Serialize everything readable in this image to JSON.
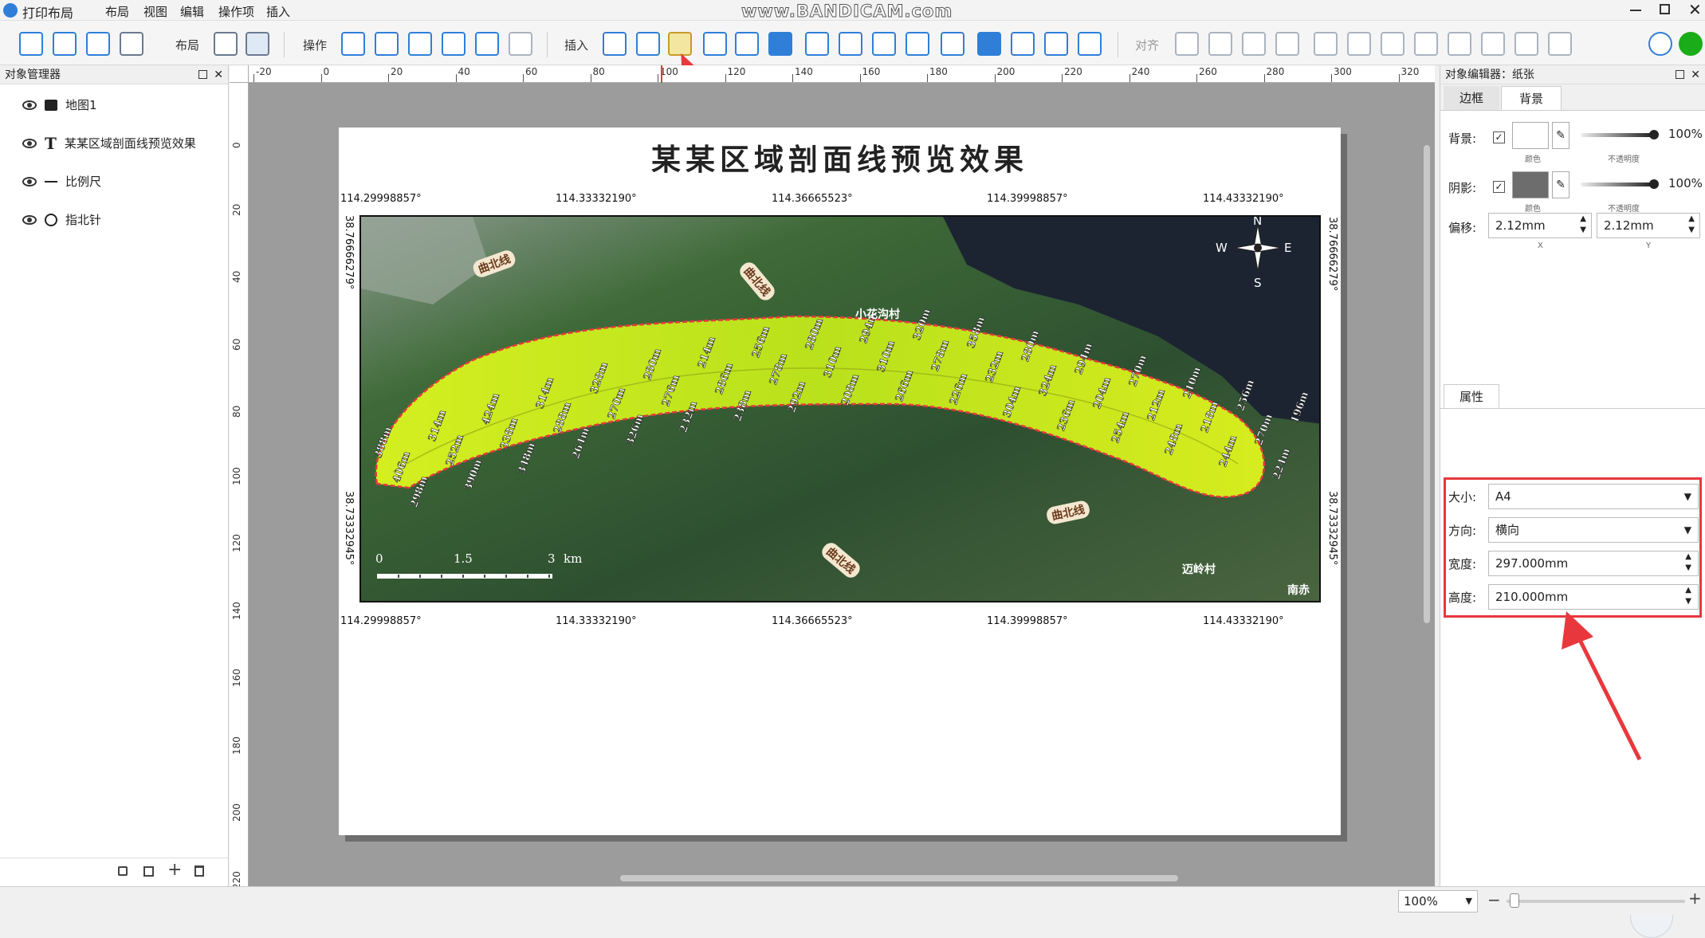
{
  "app": {
    "title": "打印布局",
    "menu": [
      "布局",
      "视图",
      "编辑",
      "操作项",
      "插入"
    ],
    "watermark": "www.BANDICAM.com"
  },
  "toolbar": {
    "layout_label": "布局",
    "ops_label": "操作",
    "insert_label": "插入",
    "align_label": "对齐"
  },
  "left_panel": {
    "title": "对象管理器",
    "items": [
      {
        "icon": "folder-icon",
        "label": "地图1"
      },
      {
        "icon": "text-icon",
        "label": "某某区域剖面线预览效果"
      },
      {
        "icon": "scalebar-icon",
        "label": "比例尺"
      },
      {
        "icon": "compass-icon",
        "label": "指北针"
      }
    ]
  },
  "rulers": {
    "top": [
      "-20",
      "0",
      "20",
      "40",
      "60",
      "80",
      "100",
      "120",
      "140",
      "160",
      "180",
      "200",
      "220",
      "240",
      "260",
      "280",
      "300",
      "320"
    ],
    "left": [
      "0",
      "20",
      "40",
      "60",
      "80",
      "100",
      "120",
      "140",
      "160",
      "180",
      "200",
      "220"
    ]
  },
  "map": {
    "title": "某某区域剖面线预览效果",
    "top_coords": [
      "114.29998857°",
      "114.33332190°",
      "114.36665523°",
      "114.39998857°",
      "114.43332190°"
    ],
    "bottom_coords": [
      "114.29998857°",
      "114.33332190°",
      "114.36665523°",
      "114.39998857°",
      "114.43332190°"
    ],
    "left_coords": [
      "38.76666279°",
      "38.73332945°"
    ],
    "right_coords": [
      "38.76666279°",
      "38.73332945°"
    ],
    "place_labels": [
      "曲北线",
      "曲北线",
      "小花沟村",
      "曲北线",
      "曲北线",
      "迈岭村",
      "南赤"
    ],
    "contour_labels": [
      "388m",
      "406m",
      "298m",
      "314m",
      "252m",
      "390m",
      "424m",
      "338m",
      "348m",
      "314m",
      "288m",
      "264m",
      "328m",
      "270m",
      "326m",
      "280m",
      "276m",
      "232m",
      "214m",
      "286m",
      "238m",
      "256m",
      "278m",
      "292m",
      "280m",
      "310m",
      "208m",
      "294m",
      "310m",
      "266m",
      "320m",
      "278m",
      "226m",
      "358m",
      "232m",
      "304m",
      "280m",
      "324m",
      "236m",
      "294m",
      "204m",
      "254m",
      "270m",
      "212m",
      "248m",
      "210m",
      "218m",
      "244m",
      "256m",
      "270m",
      "224m",
      "196m"
    ],
    "scale": {
      "labels": [
        "0",
        "1.5",
        "3"
      ],
      "unit": "km"
    },
    "compass": {
      "n": "N",
      "s": "S",
      "e": "E",
      "w": "W"
    }
  },
  "right_panel": {
    "title": "对象编辑器：纸张",
    "tabs": [
      "边框",
      "背景"
    ],
    "active_tab": "背景",
    "background": {
      "label": "背景:",
      "color_caption": "颜色",
      "opacity": "100%",
      "opacity_caption": "不透明度"
    },
    "shadow": {
      "label": "阴影:",
      "color_caption": "颜色",
      "opacity": "100%",
      "opacity_caption": "不透明度"
    },
    "offset": {
      "label": "偏移:",
      "x": "2.12mm",
      "y": "2.12mm",
      "x_caption": "X",
      "y_caption": "Y"
    },
    "props_tab": "属性",
    "props": {
      "size_label": "大小:",
      "size": "A4",
      "orient_label": "方向:",
      "orient": "横向",
      "width_label": "宽度:",
      "width": "297.000mm",
      "height_label": "高度:",
      "height": "210.000mm"
    }
  },
  "status": {
    "zoom": "100%",
    "zoom_value": 0.02
  },
  "colors": {
    "accent": "#2f7fd8",
    "highlight": "#e8383d",
    "profile_fill": "#c9e61a"
  }
}
